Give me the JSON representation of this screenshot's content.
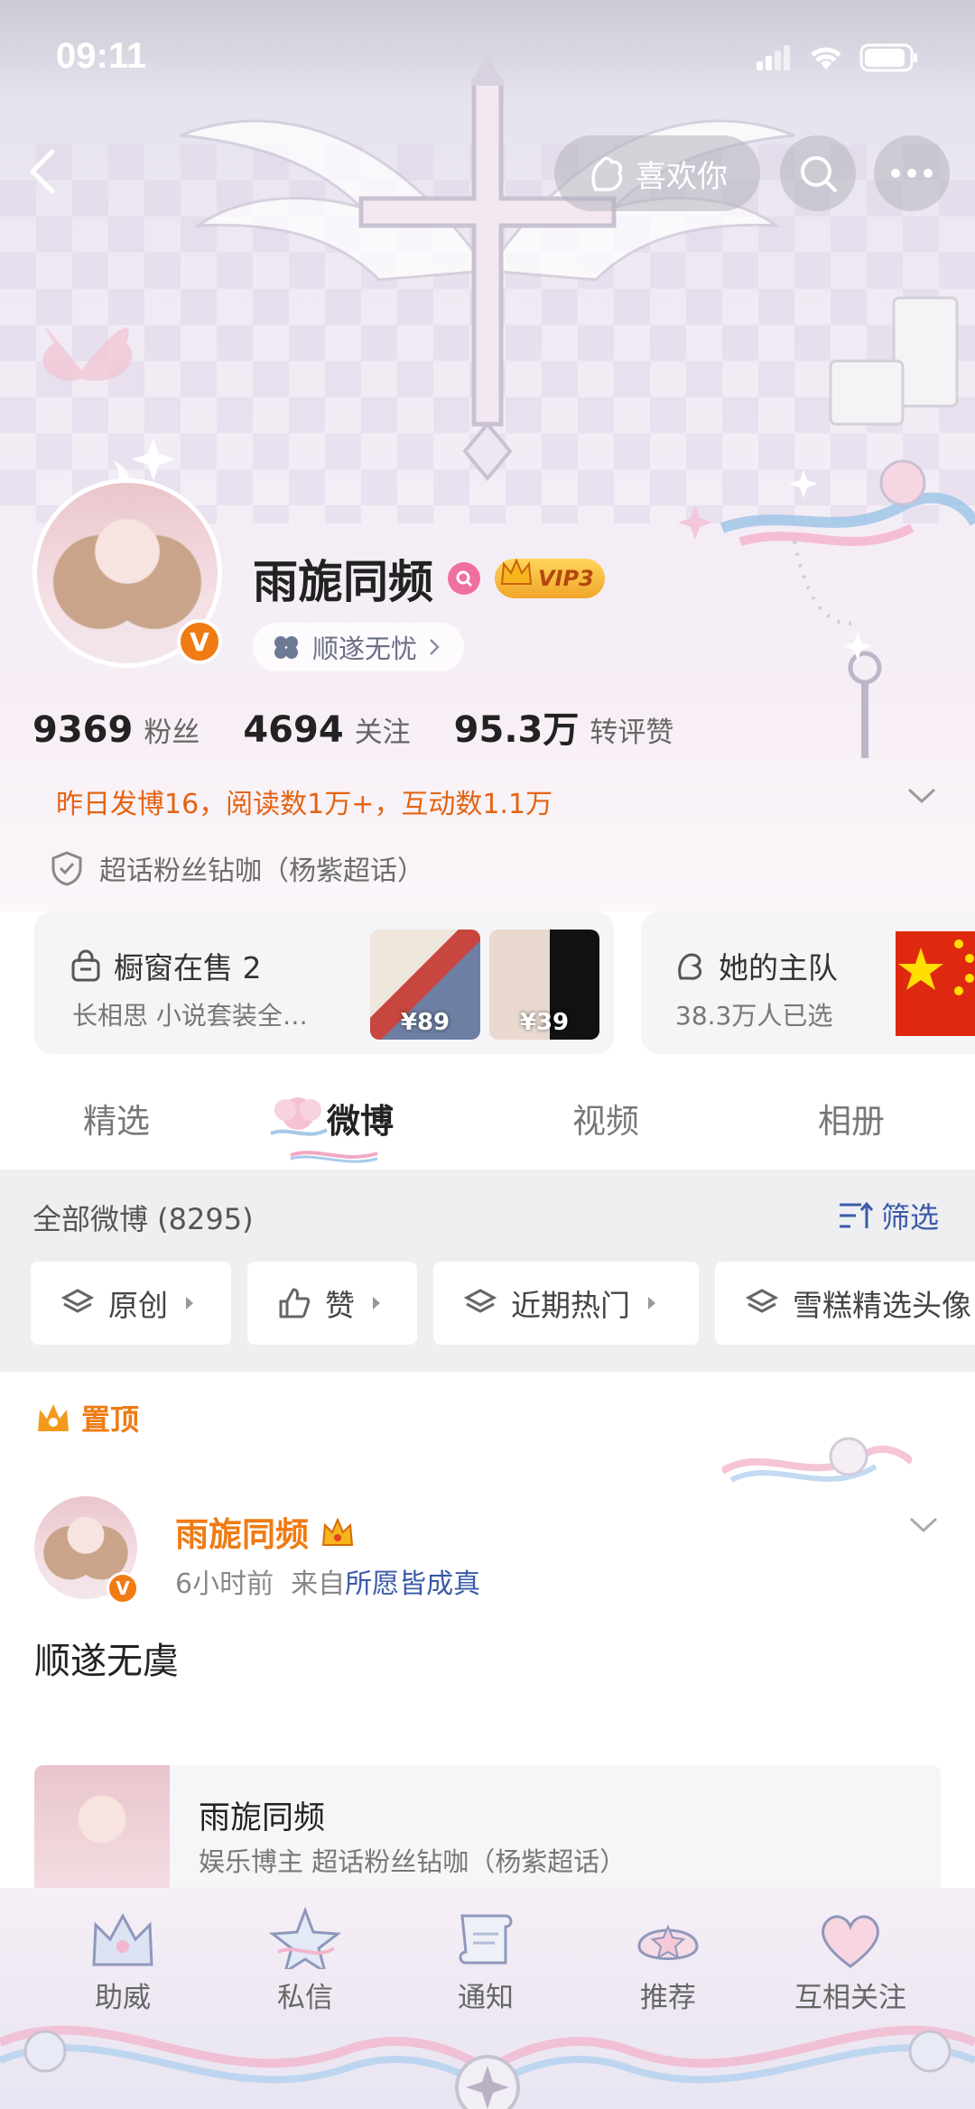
{
  "status_bar": {
    "time": "09:11"
  },
  "header": {
    "like_label": "喜欢你",
    "profile": {
      "name": "雨旎同频",
      "vip_label": "VIP3",
      "wish_label": "顺遂无忧"
    },
    "stats": [
      {
        "value": "9369",
        "label": "粉丝"
      },
      {
        "value": "4694",
        "label": "关注"
      },
      {
        "value": "95.3万",
        "label": "转评赞"
      }
    ],
    "summary": "昨日发博16，阅读数1万+，互动数1.1万",
    "supertopic": "超话粉丝钻咖（杨紫超话）"
  },
  "cards": {
    "shop": {
      "title": "橱窗在售 2",
      "subtitle": "长相思 小说套装全…",
      "prices": [
        "¥89",
        "¥39"
      ]
    },
    "team": {
      "title": "她的主队",
      "subtitle": "38.3万人已选"
    }
  },
  "tabs": [
    "精选",
    "微博",
    "视频",
    "相册"
  ],
  "filter": {
    "all_label": "全部微博 (8295)",
    "filter_label": "筛选",
    "chips": [
      "原创",
      "赞",
      "近期热门",
      "雪糕精选头像"
    ]
  },
  "post": {
    "pinned_label": "置顶",
    "author": "雨旎同频",
    "time": "6小时前",
    "from_prefix": "来自",
    "source": "所愿皆成真",
    "text": "顺遂无虞",
    "quote": {
      "name": "雨旎同频",
      "desc": "娱乐博主 超话粉丝钻咖（杨紫超话）"
    }
  },
  "bottom_nav": [
    "助威",
    "私信",
    "通知",
    "推荐",
    "互相关注"
  ],
  "colors": {
    "accent_orange": "#f07b12",
    "link_blue": "#3a5aa8",
    "summary_orange": "#e36412"
  }
}
